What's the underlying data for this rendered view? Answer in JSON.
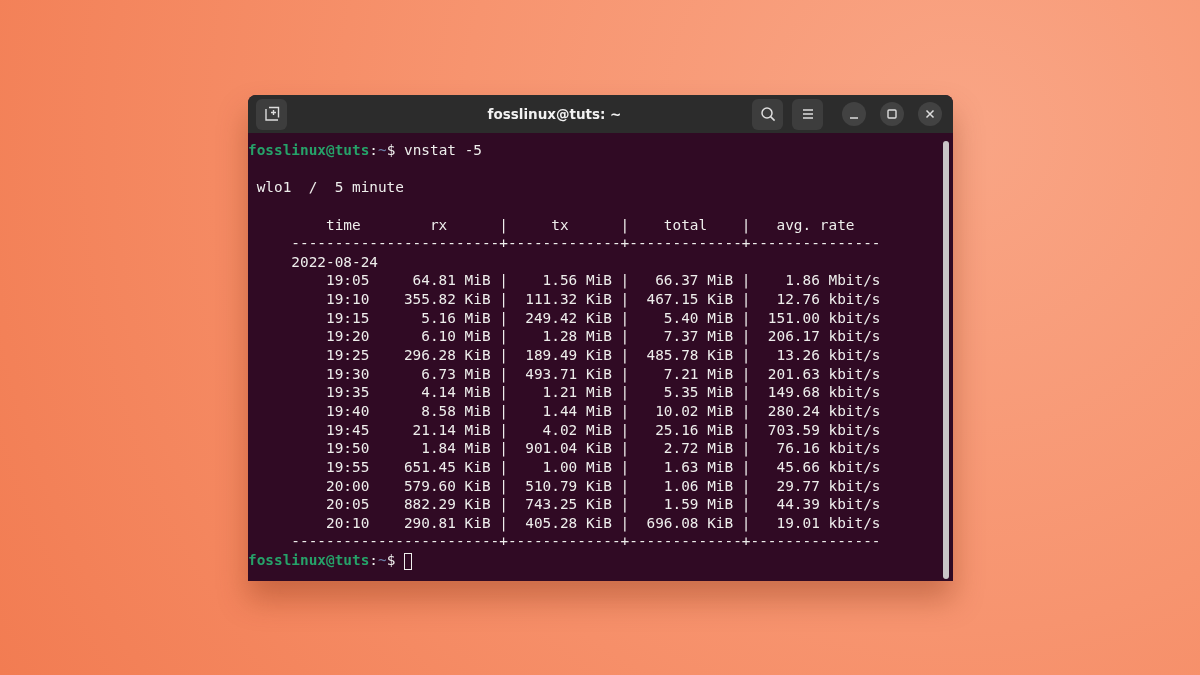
{
  "window": {
    "title": "fosslinux@tuts: ~"
  },
  "terminal": {
    "lines": [
      {
        "kind": "prompt",
        "user_host": "fosslinux@tuts",
        "separator": ":",
        "path": "~",
        "symbol": "$",
        "command": "vnstat -5",
        "cursor": false
      },
      {
        "kind": "blank"
      },
      {
        "kind": "output",
        "text": " wlo1  /  5 minute"
      },
      {
        "kind": "blank"
      },
      {
        "kind": "output",
        "text": "         time        rx      |     tx      |    total    |   avg. rate"
      },
      {
        "kind": "output",
        "text": "     ------------------------+-------------+-------------+---------------"
      },
      {
        "kind": "output",
        "text": "     2022-08-24"
      },
      {
        "kind": "output",
        "text": "         19:05     64.81 MiB |    1.56 MiB |   66.37 MiB |    1.86 Mbit/s"
      },
      {
        "kind": "output",
        "text": "         19:10    355.82 KiB |  111.32 KiB |  467.15 KiB |   12.76 kbit/s"
      },
      {
        "kind": "output",
        "text": "         19:15      5.16 MiB |  249.42 KiB |    5.40 MiB |  151.00 kbit/s"
      },
      {
        "kind": "output",
        "text": "         19:20      6.10 MiB |    1.28 MiB |    7.37 MiB |  206.17 kbit/s"
      },
      {
        "kind": "output",
        "text": "         19:25    296.28 KiB |  189.49 KiB |  485.78 KiB |   13.26 kbit/s"
      },
      {
        "kind": "output",
        "text": "         19:30      6.73 MiB |  493.71 KiB |    7.21 MiB |  201.63 kbit/s"
      },
      {
        "kind": "output",
        "text": "         19:35      4.14 MiB |    1.21 MiB |    5.35 MiB |  149.68 kbit/s"
      },
      {
        "kind": "output",
        "text": "         19:40      8.58 MiB |    1.44 MiB |   10.02 MiB |  280.24 kbit/s"
      },
      {
        "kind": "output",
        "text": "         19:45     21.14 MiB |    4.02 MiB |   25.16 MiB |  703.59 kbit/s"
      },
      {
        "kind": "output",
        "text": "         19:50      1.84 MiB |  901.04 KiB |    2.72 MiB |   76.16 kbit/s"
      },
      {
        "kind": "output",
        "text": "         19:55    651.45 KiB |    1.00 MiB |    1.63 MiB |   45.66 kbit/s"
      },
      {
        "kind": "output",
        "text": "         20:00    579.60 KiB |  510.79 KiB |    1.06 MiB |   29.77 kbit/s"
      },
      {
        "kind": "output",
        "text": "         20:05    882.29 KiB |  743.25 KiB |    1.59 MiB |   44.39 kbit/s"
      },
      {
        "kind": "output",
        "text": "         20:10    290.81 KiB |  405.28 KiB |  696.08 KiB |   19.01 kbit/s"
      },
      {
        "kind": "output",
        "text": "     ------------------------+-------------+-------------+---------------"
      },
      {
        "kind": "prompt",
        "user_host": "fosslinux@tuts",
        "separator": ":",
        "path": "~",
        "symbol": "$",
        "cursor": true
      }
    ]
  }
}
